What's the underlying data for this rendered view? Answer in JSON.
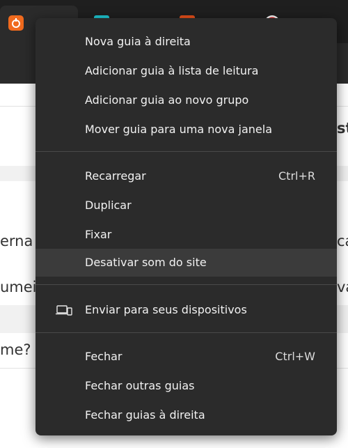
{
  "menu": {
    "items": [
      {
        "label": "Nova guia à direita"
      },
      {
        "label": "Adicionar guia à lista de leitura"
      },
      {
        "label": "Adicionar guia ao novo grupo"
      },
      {
        "label": "Mover guia para uma nova janela"
      },
      {
        "label": "Recarregar",
        "shortcut": "Ctrl+R"
      },
      {
        "label": "Duplicar"
      },
      {
        "label": "Fixar"
      },
      {
        "label": "Desativar som do site"
      },
      {
        "label": "Enviar para seus dispositivos",
        "icon": "devices-icon"
      },
      {
        "label": "Fechar",
        "shortcut": "Ctrl+W"
      },
      {
        "label": "Fechar outras guias"
      },
      {
        "label": "Fechar guias à direita"
      }
    ]
  },
  "page": {
    "fragments": [
      "erna",
      "umei",
      "me?",
      "sta",
      "ca",
      "va"
    ]
  },
  "colors": {
    "menu_bg": "#2b2b2b",
    "hover_bg": "#3b3b3b",
    "tab_icon_1": "#f06a1e",
    "tab_icon_2": "#1ec8d4",
    "tab_icon_3": "#e8501a",
    "tab_icon_4": "#e03030"
  }
}
